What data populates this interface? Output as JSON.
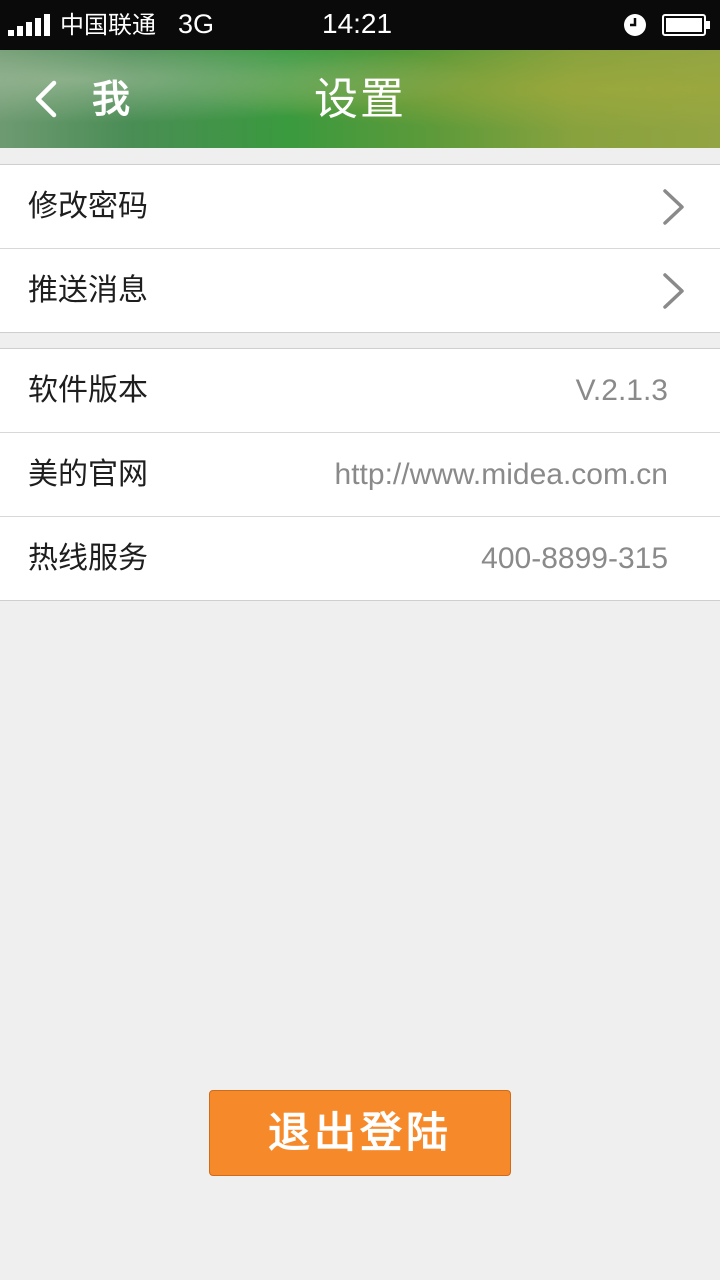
{
  "status_bar": {
    "carrier": "中国联通",
    "network": "3G",
    "time": "14:21",
    "icons": [
      "signal-icon",
      "alarm-icon",
      "battery-icon"
    ]
  },
  "header": {
    "back_label": "我",
    "title": "设置",
    "back_icon": "chevron-left-icon"
  },
  "settings_group_1": [
    {
      "label": "修改密码",
      "icon": "chevron-right-icon"
    },
    {
      "label": "推送消息",
      "icon": "chevron-right-icon"
    }
  ],
  "settings_group_2": [
    {
      "label": "软件版本",
      "value": "V.2.1.3"
    },
    {
      "label": "美的官网",
      "value": "http://www.midea.com.cn"
    },
    {
      "label": "热线服务",
      "value": "400-8899-315"
    }
  ],
  "logout": {
    "label": "退出登陆"
  },
  "colors": {
    "status_bar": "#0a0a0a",
    "header_green": "#3a9a3e",
    "logout_orange": "#f68a2b",
    "value_gray": "#8a8a8a",
    "background": "#efefef"
  }
}
